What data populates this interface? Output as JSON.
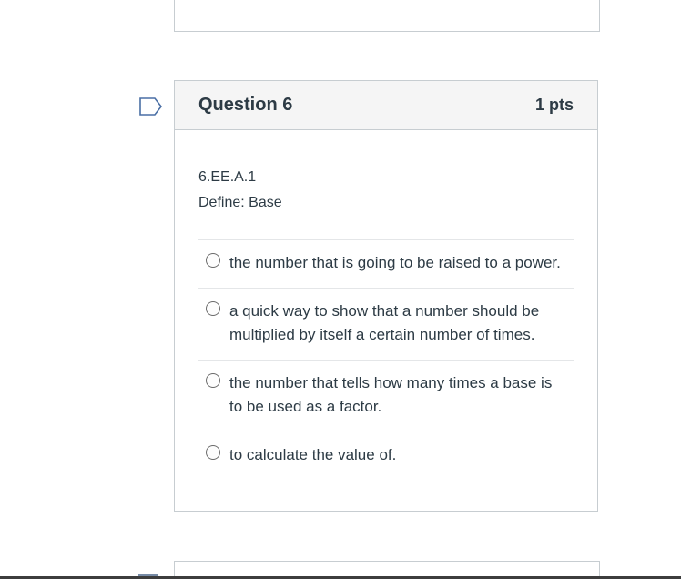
{
  "question": {
    "title": "Question 6",
    "points": "1 pts",
    "standard": "6.EE.A.1",
    "prompt": "Define:  Base",
    "answers": [
      {
        "label": "the number that is going to be raised to a power."
      },
      {
        "label": "a quick way to show that a number should be multiplied by itself a certain number of times."
      },
      {
        "label": "the number that tells how many times a base is to be used as a factor."
      },
      {
        "label": "to calculate the value of."
      }
    ]
  },
  "icons": {
    "flag": "bookmark-flag-icon",
    "radio": "radio-button-icon"
  },
  "colors": {
    "header_bg": "#f5f5f5",
    "border": "#c7cdd1",
    "text": "#2d3b45",
    "flag_stroke": "#4a6fa5"
  }
}
